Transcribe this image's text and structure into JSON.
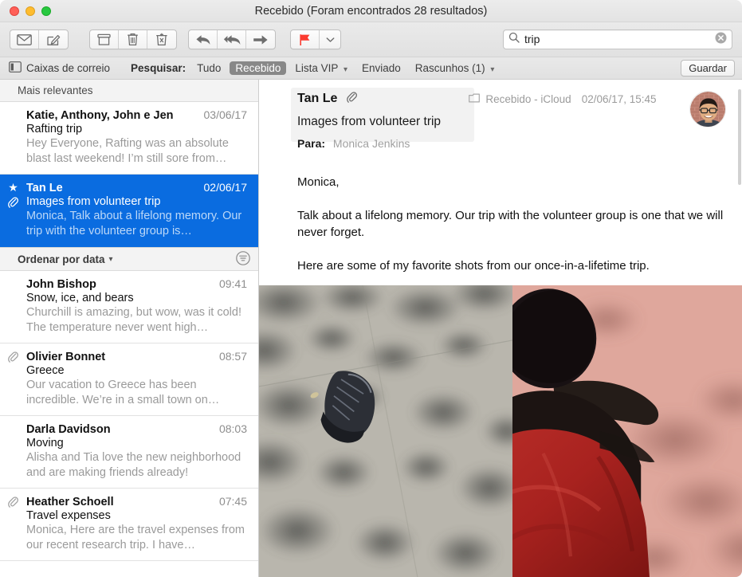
{
  "window": {
    "title": "Recebido (Foram encontrados 28 resultados)",
    "traffic": {
      "close": "close-button",
      "minimize": "minimize-button",
      "zoom": "zoom-button"
    }
  },
  "toolbar": {
    "buttons": [
      {
        "name": "get-mail-button",
        "icon": "envelope-icon",
        "label": "Obter e-mail"
      },
      {
        "name": "compose-button",
        "icon": "compose-icon",
        "label": "Nova mensagem"
      },
      {
        "name": "archive-button",
        "icon": "archive-box-icon",
        "label": "Arquivar"
      },
      {
        "name": "delete-button",
        "icon": "trash-icon",
        "label": "Apagar"
      },
      {
        "name": "junk-button",
        "icon": "junk-trash-icon",
        "label": "Lixo eletrónico"
      },
      {
        "name": "reply-button",
        "icon": "reply-arrow-icon",
        "label": "Responder"
      },
      {
        "name": "reply-all-button",
        "icon": "reply-all-arrow-icon",
        "label": "Responder a todos"
      },
      {
        "name": "forward-button",
        "icon": "forward-arrow-icon",
        "label": "Reencaminhar"
      },
      {
        "name": "flag-button",
        "icon": "flag-icon",
        "label": "Sinalizar"
      },
      {
        "name": "flag-menu-button",
        "icon": "chevron-down-icon",
        "label": "Opções de sinalizador"
      }
    ],
    "flag_color": "#fb3b30"
  },
  "search": {
    "value": "trip",
    "placeholder": "Pesquisar",
    "icon": "search-icon",
    "clear_icon": "clear-circle-icon"
  },
  "filterbar": {
    "mailboxes_label": "Caixas de correio",
    "mailboxes_icon": "sidebar-panel-icon",
    "search_label": "Pesquisar:",
    "scopes": [
      {
        "label": "Tudo",
        "active": false,
        "has_menu": false
      },
      {
        "label": "Recebido",
        "active": true,
        "has_menu": false
      },
      {
        "label": "Lista VIP",
        "active": false,
        "has_menu": true
      },
      {
        "label": "Enviado",
        "active": false,
        "has_menu": false
      },
      {
        "label": "Rascunhos (1)",
        "active": false,
        "has_menu": true
      }
    ],
    "save_label": "Guardar",
    "active_color": "#888888"
  },
  "message_list": {
    "section_header": "Mais relevantes",
    "sort_label": "Ordenar por data",
    "sort_chevron_icon": "chevron-down-icon",
    "filter_icon": "filter-funnel-icon",
    "selected_color": "#0a6ce0",
    "top_results": [
      {
        "sender": "Katie, Anthony, John e Jen",
        "date": "03/06/17",
        "subject": "Rafting trip",
        "preview": "Hey Everyone, Rafting was an absolute blast last weekend! I’m still sore from…",
        "selected": false,
        "vip": false,
        "attachment": false
      },
      {
        "sender": "Tan Le",
        "date": "02/06/17",
        "subject": "Images from volunteer trip",
        "preview": "Monica, Talk about a lifelong memory. Our trip with the volunteer group is…",
        "selected": true,
        "vip": true,
        "attachment": true
      }
    ],
    "messages": [
      {
        "sender": "John Bishop",
        "date": "09:41",
        "subject": "Snow, ice, and bears",
        "preview": "Churchill is amazing, but wow, was it cold! The temperature never went high…",
        "selected": false,
        "vip": false,
        "attachment": false
      },
      {
        "sender": "Olivier Bonnet",
        "date": "08:57",
        "subject": "Greece",
        "preview": "Our vacation to Greece has been incredible. We’re in a small town on…",
        "selected": false,
        "vip": false,
        "attachment": true
      },
      {
        "sender": "Darla Davidson",
        "date": "08:03",
        "subject": "Moving",
        "preview": "Alisha and Tia love the new neighborhood and are making friends already!",
        "selected": false,
        "vip": false,
        "attachment": false
      },
      {
        "sender": "Heather Schoell",
        "date": "07:45",
        "subject": "Travel expenses",
        "preview": "Monica, Here are the travel expenses from our recent research trip. I have…",
        "selected": false,
        "vip": false,
        "attachment": true
      }
    ]
  },
  "message_view": {
    "from": "Tan Le",
    "attachment_icon": "paperclip-icon",
    "mailbox_icon": "folder-icon",
    "mailbox": "Recebido - iCloud",
    "timestamp": "02/06/17, 15:45",
    "avatar": "sender-avatar",
    "subject": "Images from volunteer trip",
    "to_label": "Para:",
    "to_value": "Monica Jenkins",
    "body": [
      "Monica,",
      "Talk about a lifelong memory. Our trip with the volunteer group is one that we will never forget.",
      "Here are some of my favorite shots from our once-in-a-lifetime trip."
    ],
    "attachments": [
      {
        "name": "photo-attachment-left",
        "alt": "Pavement with dappled tree shadows and a sneaker"
      },
      {
        "name": "photo-attachment-right",
        "alt": "Person in a red shirt seen from behind on pink ground"
      }
    ]
  }
}
